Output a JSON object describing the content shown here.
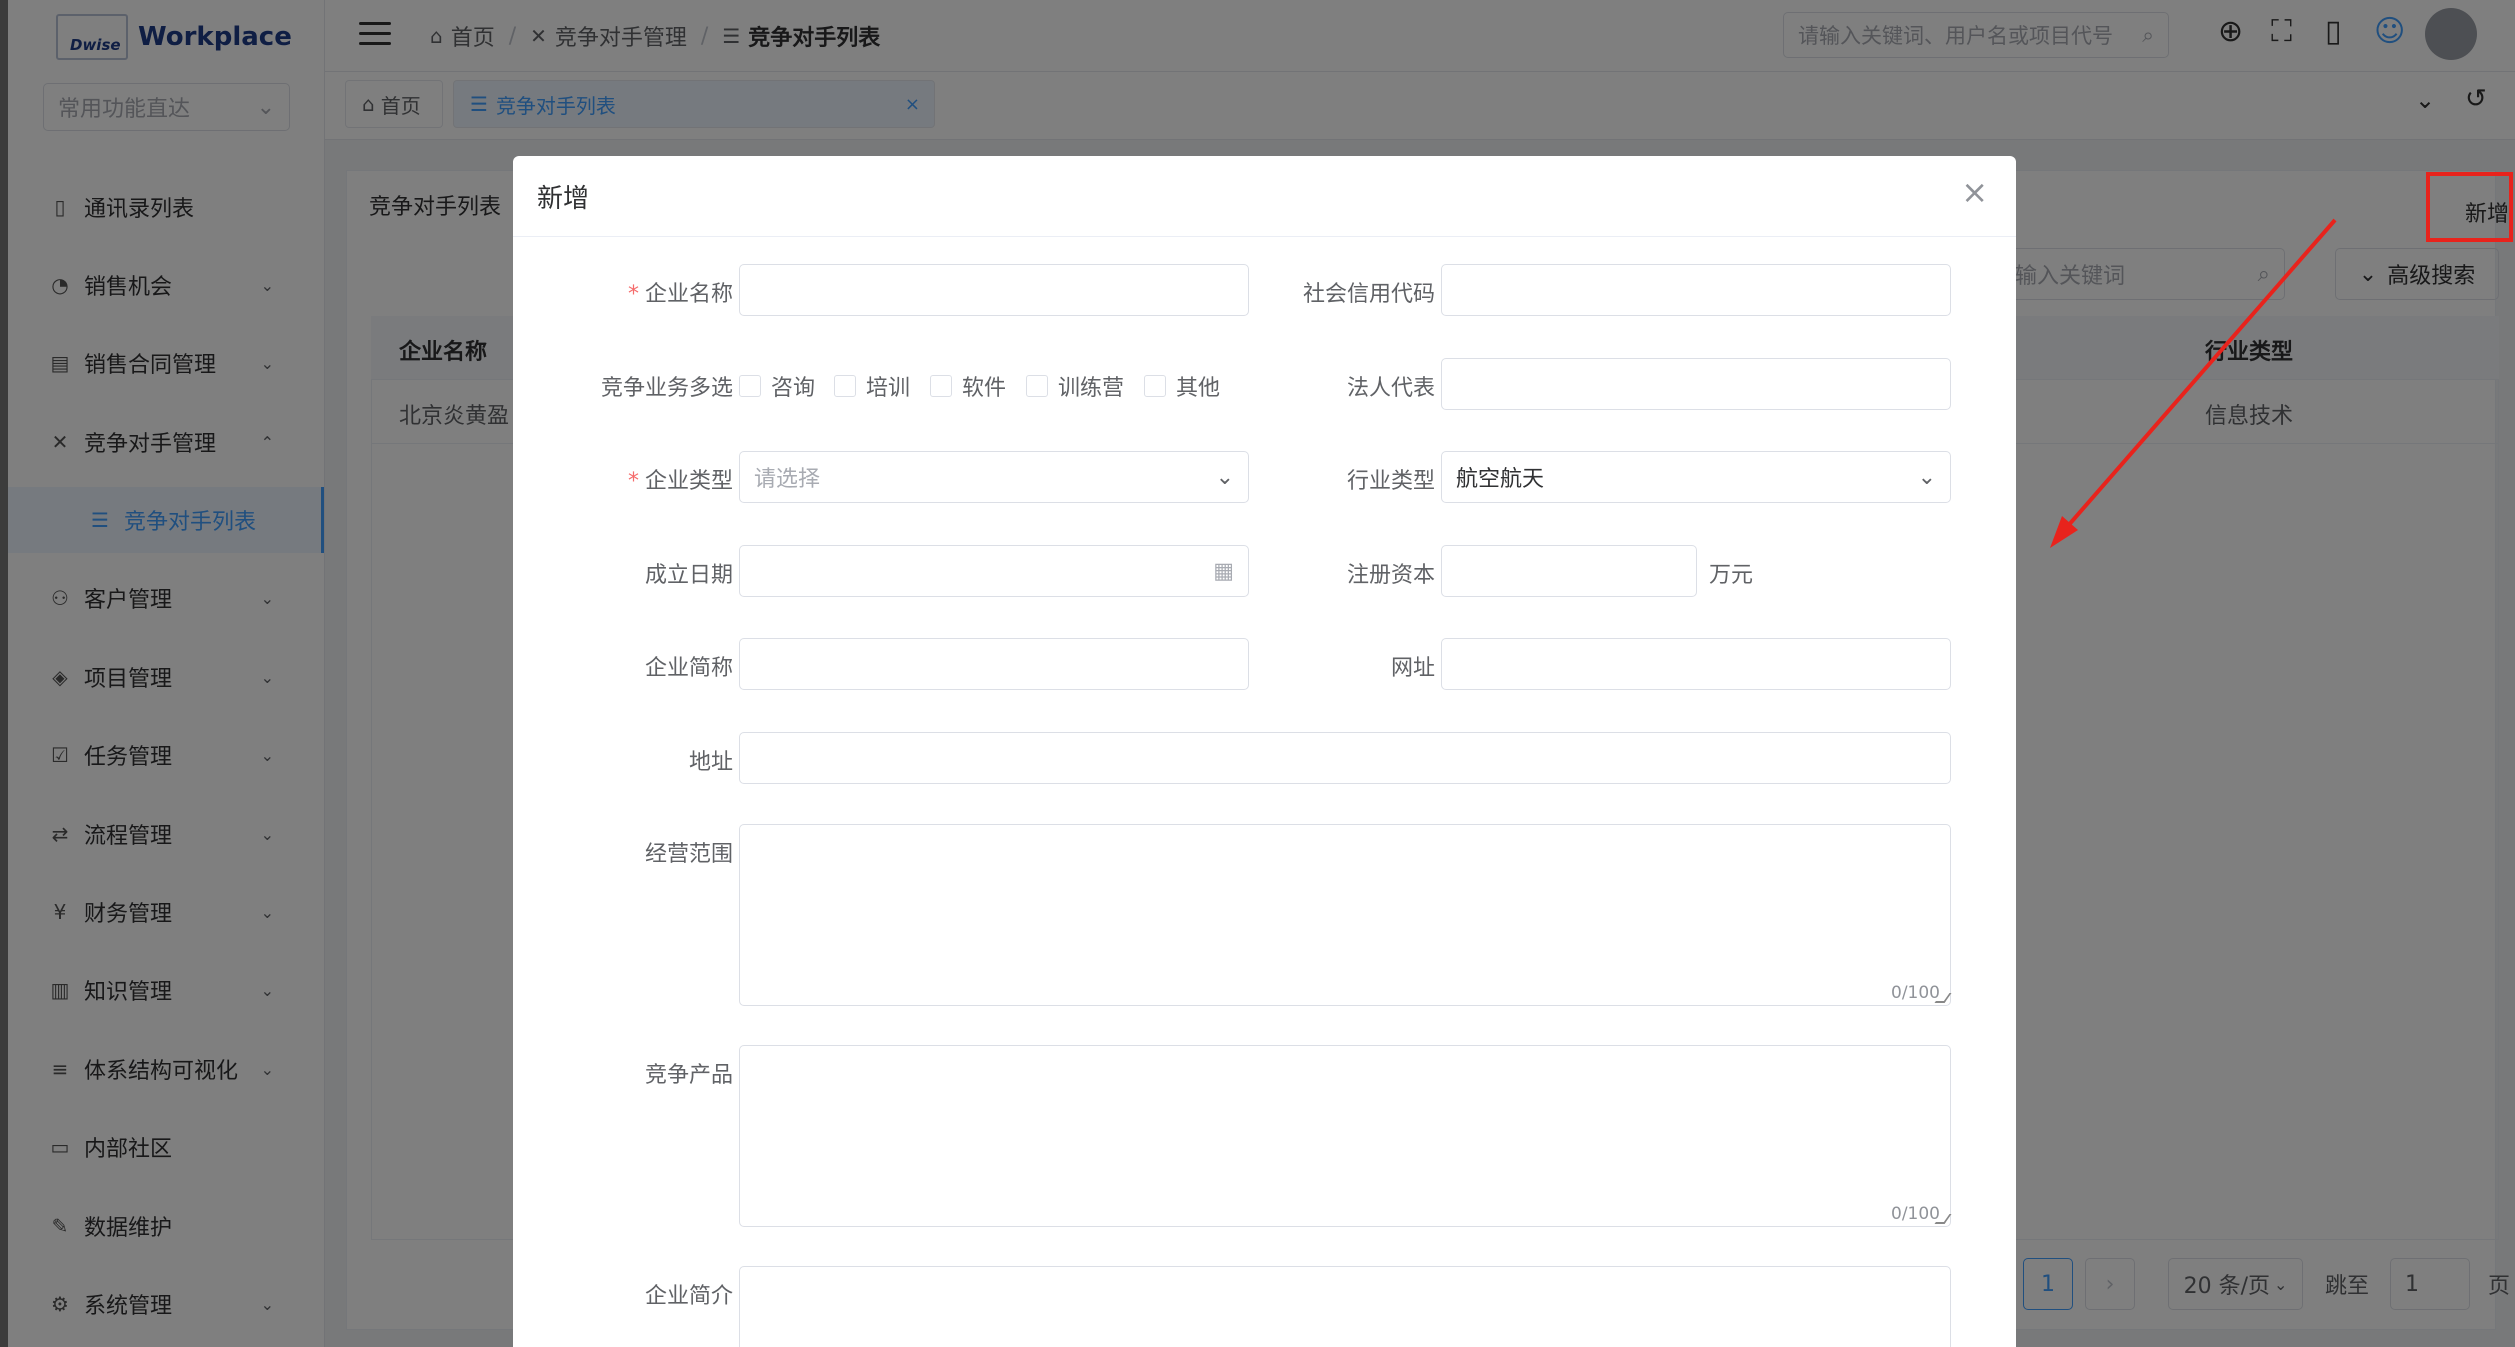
{
  "app": {
    "brand_small": "Dwise",
    "brand_name": "Workplace"
  },
  "sidebar": {
    "quick_placeholder": "常用功能直达",
    "items": [
      {
        "label": "通讯录列表",
        "icon": "contacts-icon"
      },
      {
        "label": "销售机会",
        "icon": "pie-chart-icon"
      },
      {
        "label": "销售合同管理",
        "icon": "contract-icon"
      },
      {
        "label": "竞争对手管理",
        "icon": "crossed-swords-icon"
      },
      {
        "label": "竞争对手列表",
        "icon": "list-icon"
      },
      {
        "label": "客户管理",
        "icon": "user-icon"
      },
      {
        "label": "项目管理",
        "icon": "layers-icon"
      },
      {
        "label": "任务管理",
        "icon": "task-icon"
      },
      {
        "label": "流程管理",
        "icon": "flow-icon"
      },
      {
        "label": "财务管理",
        "icon": "finance-icon"
      },
      {
        "label": "知识管理",
        "icon": "book-icon"
      },
      {
        "label": "体系结构可视化",
        "icon": "menu-icon"
      },
      {
        "label": "内部社区",
        "icon": "chat-icon"
      },
      {
        "label": "数据维护",
        "icon": "wrench-icon"
      },
      {
        "label": "系统管理",
        "icon": "gear-icon"
      }
    ]
  },
  "header": {
    "breadcrumb": [
      "首页",
      "竞争对手管理",
      "竞争对手列表"
    ],
    "search_placeholder": "请输入关键词、用户名或项目代号"
  },
  "tabs": [
    {
      "label": "首页"
    },
    {
      "label": "竞争对手列表",
      "close": "×"
    }
  ],
  "main": {
    "title": "竞争对手列表",
    "add_button": "新增",
    "search_placeholder": "输入关键词",
    "advanced_search": "高级搜索",
    "table": {
      "columns": [
        "企业名称",
        "行业类型"
      ],
      "rows": [
        [
          "北京炎黄盈",
          "信息技术"
        ]
      ]
    },
    "pager": {
      "page": "1",
      "page_size": "20 条/页",
      "jump_label": "跳至",
      "jump_value": "1",
      "page_suffix": "页"
    }
  },
  "dialog": {
    "title": "新增",
    "fields": {
      "company_name": "企业名称",
      "credit_code": "社会信用代码",
      "business_multi": "竞争业务多选",
      "legal_rep": "法人代表",
      "company_type": "企业类型",
      "company_type_placeholder": "请选择",
      "industry": "行业类型",
      "industry_value": "航空航天",
      "found_date": "成立日期",
      "capital": "注册资本",
      "capital_unit": "万元",
      "short_name": "企业简称",
      "website": "网址",
      "address": "地址",
      "scope": "经营范围",
      "products": "竞争产品",
      "intro": "企业简介",
      "counter": "0/100"
    },
    "business_options": [
      "咨询",
      "培训",
      "软件",
      "训练营",
      "其他"
    ]
  },
  "colors": {
    "accent": "#409eff",
    "required": "#f56c6c",
    "annotation": "#e8231c"
  }
}
